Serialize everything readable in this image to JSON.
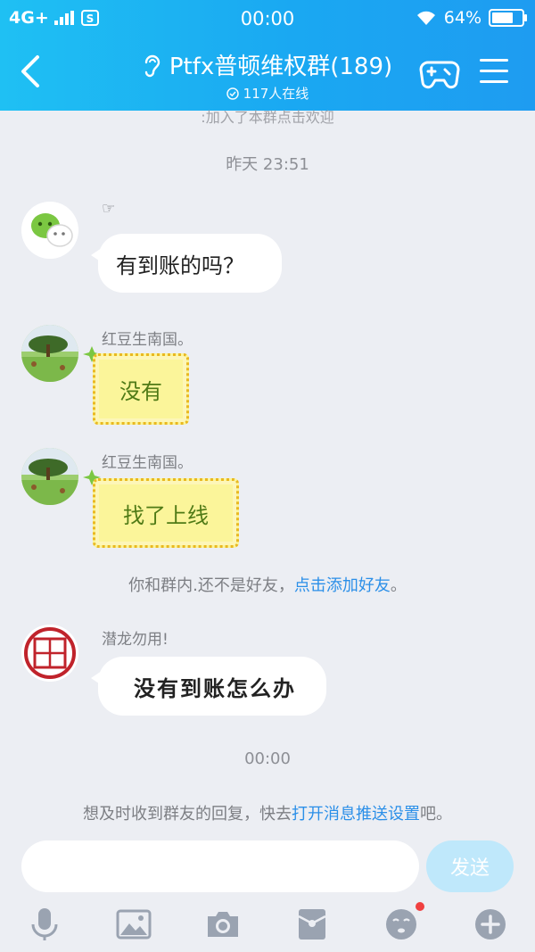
{
  "status_bar": {
    "network": "4G+",
    "time": "00:00",
    "battery": "64%",
    "battery_level": 0.64
  },
  "header": {
    "title": "Ptfx普顿维权群(189)",
    "online": "117人在线"
  },
  "chat": {
    "partial_notice": ":加入了本群点击欢迎",
    "timestamp_1": "昨天 23:51",
    "messages": [
      {
        "nickname": "☞",
        "text": "有到账的吗？"
      },
      {
        "nickname": "红豆生南国。",
        "text": "没有"
      },
      {
        "nickname": "红豆生南国。",
        "text": "找了上线"
      },
      {
        "nickname": "潜龙勿用!",
        "text": "没有到账怎么办"
      }
    ],
    "friend_notice": {
      "prefix": "你和群内.还不是好友，",
      "link": "点击添加好友",
      "suffix": "。"
    },
    "timestamp_2": "00:00",
    "push_notice": {
      "prefix": "想及时收到群友的回复，快去",
      "link": "打开消息推送设置",
      "suffix": "吧。"
    }
  },
  "input": {
    "placeholder": "",
    "send_label": "发送"
  },
  "toolbar": {
    "icons": [
      "microphone-icon",
      "image-icon",
      "camera-icon",
      "red-packet-icon",
      "emoji-icon",
      "plus-icon"
    ]
  },
  "colors": {
    "header_start": "#1fc0f3",
    "header_end": "#1e9cf1",
    "link": "#2b8fe8",
    "send_button": "#bfe8fb"
  }
}
